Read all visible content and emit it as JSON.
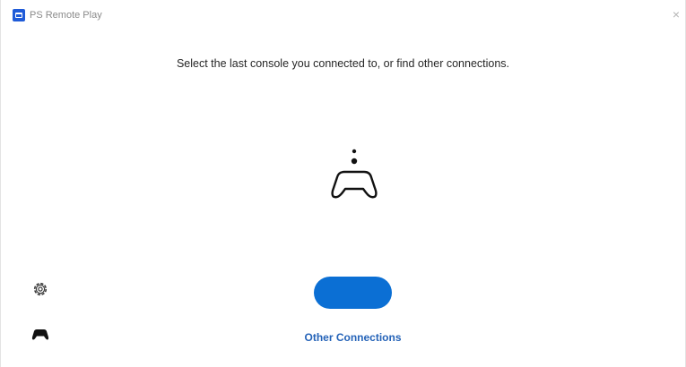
{
  "window": {
    "title": "PS Remote Play",
    "close_label": "×"
  },
  "main": {
    "instructions": "Select the last console you connected to, or find other connections.",
    "connect_button_label": "",
    "other_connections_label": "Other Connections"
  },
  "sidebar": {
    "items": [
      {
        "icon": "gear-icon"
      },
      {
        "icon": "controller-icon"
      }
    ]
  },
  "colors": {
    "accent": "#0b6fd4",
    "link": "#2563b8",
    "app_icon": "#1f5bd8"
  }
}
